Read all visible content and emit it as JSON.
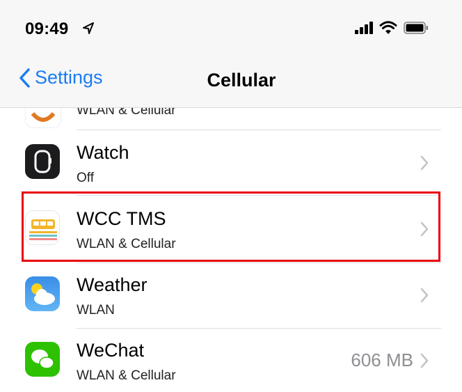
{
  "status": {
    "time": "09:49",
    "location_icon": "location-arrow-icon",
    "signal_icon": "cellular-signal-icon",
    "wifi_icon": "wifi-icon",
    "battery_icon": "battery-icon"
  },
  "nav": {
    "back_label": "Settings",
    "title": "Cellular"
  },
  "rows": [
    {
      "name": "",
      "subtitle": "WLAN & Cellular",
      "value": "",
      "icon": "partial-app-icon"
    },
    {
      "name": "Watch",
      "subtitle": "Off",
      "value": "",
      "icon": "watch-app-icon"
    },
    {
      "name": "WCC TMS",
      "subtitle": "WLAN & Cellular",
      "value": "",
      "icon": "bus-app-icon"
    },
    {
      "name": "Weather",
      "subtitle": "WLAN",
      "value": "",
      "icon": "weather-app-icon"
    },
    {
      "name": "WeChat",
      "subtitle": "WLAN & Cellular",
      "value": "606 MB",
      "icon": "wechat-app-icon"
    }
  ],
  "colors": {
    "accent": "#1a7cf5",
    "highlight": "#e8000b"
  }
}
